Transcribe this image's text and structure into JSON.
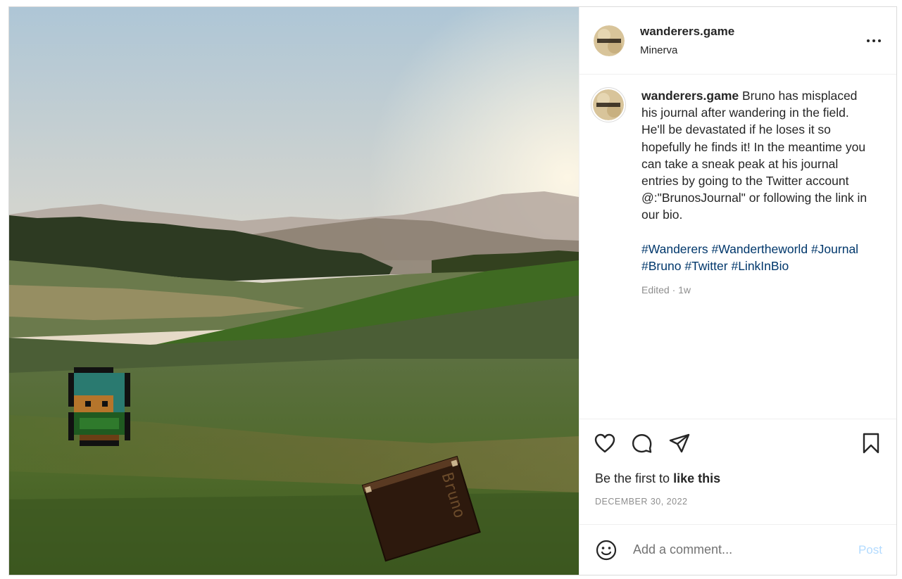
{
  "post": {
    "username": "wanderers.game",
    "location": "Minerva",
    "avatar_text": "Wanderers",
    "caption_user": "wanderers.game",
    "caption_body": " Bruno has misplaced his journal after wandering in the field. He'll be devastated if he loses it so hopefully he finds it! In the meantime you can take a sneak peak at his journal entries by going to the Twitter account @:\"BrunosJournal\" or following the link in our bio.",
    "hashtags": [
      "#Wanderers",
      "#Wandertheworld",
      "#Journal",
      "#Bruno",
      "#Twitter",
      "#LinkInBio"
    ],
    "meta": "Edited · 1w",
    "book_label": "Bruno"
  },
  "actions": {
    "icons": [
      "heart-icon",
      "comment-icon",
      "share-icon",
      "bookmark-icon"
    ],
    "likes_prefix": "Be the first to ",
    "likes_strong": "like this",
    "date": "DECEMBER 30, 2022"
  },
  "comment": {
    "placeholder": "Add a comment...",
    "post_label": "Post"
  },
  "colors": {
    "hashtag": "#00376b",
    "post_button_disabled": "#b3dbff",
    "border": "#dbdbdb"
  }
}
